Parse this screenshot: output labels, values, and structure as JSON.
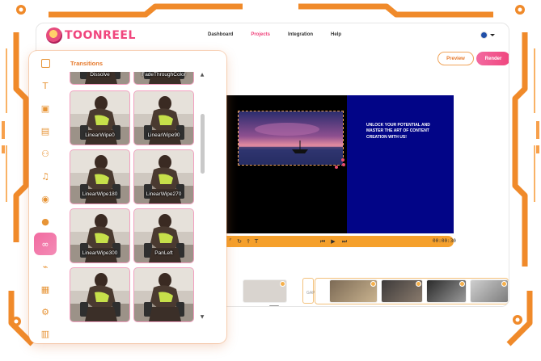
{
  "brand": {
    "name": "TOONREEL"
  },
  "nav": {
    "items": [
      "Dashboard",
      "Projects",
      "Integration",
      "Help"
    ],
    "active_index": 1
  },
  "toolbar": {
    "preview_label": "Preview",
    "render_label": "Render"
  },
  "canvas": {
    "headline": "UNLOCK YOUR POTENTIAL AND MASTER THE ART OF CONTENT CREATION WITH US!",
    "time_display": "00:00:30"
  },
  "panel": {
    "title": "Transitions",
    "items": [
      {
        "label": "Dissolve"
      },
      {
        "label": "FadeThroughColor"
      },
      {
        "label": "LinearWipe0"
      },
      {
        "label": "LinearWipe90"
      },
      {
        "label": "LinearWipe180"
      },
      {
        "label": "LinearWipe270"
      },
      {
        "label": "LinearWipe300"
      },
      {
        "label": "PanLeft"
      },
      {
        "label": ""
      },
      {
        "label": ""
      }
    ]
  },
  "rail_icons": [
    "layout-icon",
    "text-icon",
    "image-icon",
    "video-icon",
    "people-icon",
    "music-icon",
    "voice-icon",
    "user-icon",
    "link-icon",
    "attachment-icon",
    "grid-icon",
    "settings-icon",
    "film-icon"
  ],
  "timeline": {
    "gap_label": "GAP"
  },
  "colors": {
    "accent": "#F0457D",
    "orange": "#F5A02C",
    "canvas_blue": "#020587"
  }
}
